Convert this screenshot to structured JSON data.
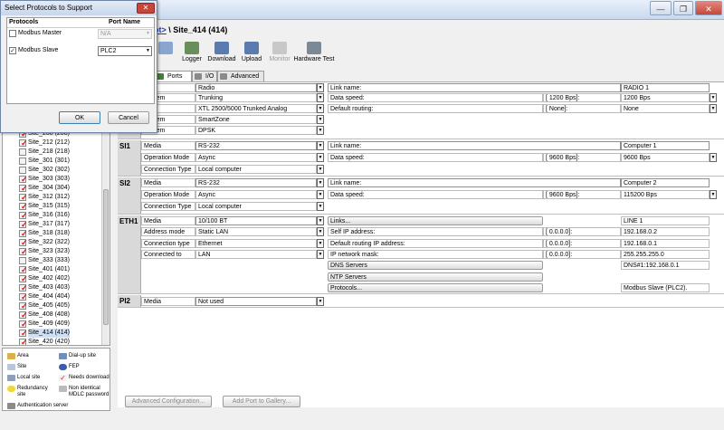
{
  "window": {
    "minimize": "—",
    "maximize": "❐",
    "close": "✕"
  },
  "breadcrumb": {
    "parent": "ot>",
    "separator": " \\ ",
    "current": "Site_414 (414)"
  },
  "toolbar": {
    "logger": "Logger",
    "download": "Download",
    "upload": "Upload",
    "monitor": "Monitor",
    "hardware_test": "Hardware Test"
  },
  "tabs": {
    "ports": "Ports",
    "io": "I/O",
    "advanced": "Advanced"
  },
  "radio_section": {
    "rows": [
      {
        "key": "",
        "value": "Radio"
      },
      {
        "key": "System",
        "value": "Trunking"
      },
      {
        "key": "Type",
        "value": "XTL 2500/5000 Trunked Analog"
      },
      {
        "key": "System",
        "value": "SmartZone"
      },
      {
        "key": "Modem",
        "value": "DPSK"
      }
    ],
    "right": [
      {
        "label": "Link name:",
        "value1": "",
        "value2": "RADIO 1"
      },
      {
        "label": "Data speed:",
        "value1": "[  1200 Bps]:",
        "value2": "1200 Bps"
      },
      {
        "label": "Default routing:",
        "value1": "[  None]:",
        "value2": "None"
      }
    ]
  },
  "si1": {
    "label": "SI1",
    "rows": [
      {
        "key": "Media",
        "value": "RS-232"
      },
      {
        "key": "Operation Mode",
        "value": "Async"
      },
      {
        "key": "Connection Type",
        "value": "Local computer"
      }
    ],
    "right": [
      {
        "label": "Link name:",
        "value1": "",
        "value2": "Computer 1"
      },
      {
        "label": "Data speed:",
        "value1": "[  9600  Bps]:",
        "value2": "9600  Bps"
      }
    ]
  },
  "si2": {
    "label": "SI2",
    "rows": [
      {
        "key": "Media",
        "value": "RS-232"
      },
      {
        "key": "Operation Mode",
        "value": "Async"
      },
      {
        "key": "Connection Type",
        "value": "Local computer"
      }
    ],
    "right": [
      {
        "label": "Link name:",
        "value1": "",
        "value2": "Computer 2"
      },
      {
        "label": "Data speed:",
        "value1": "[  9600  Bps]:",
        "value2": "115200 Bps"
      }
    ]
  },
  "eth1": {
    "label": "ETH1",
    "rows": [
      {
        "key": "Media",
        "value": "10/100 BT"
      },
      {
        "key": "Address mode",
        "value": "Static LAN"
      },
      {
        "key": "Connection type",
        "value": "Ethernet"
      },
      {
        "key": "Connected to",
        "value": "LAN"
      }
    ],
    "links_button": "Links...",
    "links_value": "LINE 1",
    "right": [
      {
        "label": "Self IP address:",
        "value1": "[  0.0.0.0]:",
        "value2": "192.168.0.2"
      },
      {
        "label": "Default routing IP address:",
        "value1": "[  0.0.0.0]:",
        "value2": "192.168.0.1"
      },
      {
        "label": "IP network mask:",
        "value1": "[  0.0.0.0]:",
        "value2": "255.255.255.0"
      }
    ],
    "dns_button": "DNS Servers",
    "dns_value": "DNS#1:192.168.0.1",
    "ntp_button": "NTP Servers",
    "protocols_button": "Protocols...",
    "protocols_value": "Modbus Slave (PLC2)."
  },
  "pi2": {
    "label": "PI2",
    "key": "Media",
    "value": "Not used"
  },
  "tree": {
    "items": [
      "Site_208 (208)",
      "Site_212 (212)",
      "Site_218 (218)",
      "Site_301 (301)",
      "Site_302 (302)",
      "Site_303 (303)",
      "Site_304 (304)",
      "Site_312 (312)",
      "Site_315 (315)",
      "Site_316 (316)",
      "Site_317 (317)",
      "Site_318 (318)",
      "Site_322 (322)",
      "Site_323 (323)",
      "Site_333 (333)",
      "Site_401 (401)",
      "Site_402 (402)",
      "Site_403 (403)",
      "Site_404 (404)",
      "Site_405 (405)",
      "Site_408 (408)",
      "Site_409 (409)",
      "Site_414 (414)",
      "Site_420 (420)"
    ]
  },
  "legend": {
    "area": "Area",
    "dialup": "Dial-up site",
    "site": "Site",
    "fep": "FEP",
    "local": "Local site",
    "needs_download": "Needs download",
    "redundancy": "Redundancy site",
    "non_identical": "Non identical MDLC password",
    "auth": "Authentication server"
  },
  "bottom": {
    "advanced_config": "Advanced Configuration...",
    "add_port": "Add Port to Gallery..."
  },
  "dialog": {
    "title": "Select Protocols to Support",
    "close": "✕",
    "col_protocols": "Protocols",
    "col_port": "Port Name",
    "rows": [
      {
        "name": "Modbus Master",
        "checked": false,
        "port": "N/A"
      },
      {
        "name": "Modbus Slave",
        "checked": true,
        "port": "PLC2"
      }
    ],
    "ok": "OK",
    "cancel": "Cancel"
  },
  "colors": {
    "accent": "#1a3fb0",
    "check_red": "#d21b1b",
    "close_red": "#c7463a"
  }
}
